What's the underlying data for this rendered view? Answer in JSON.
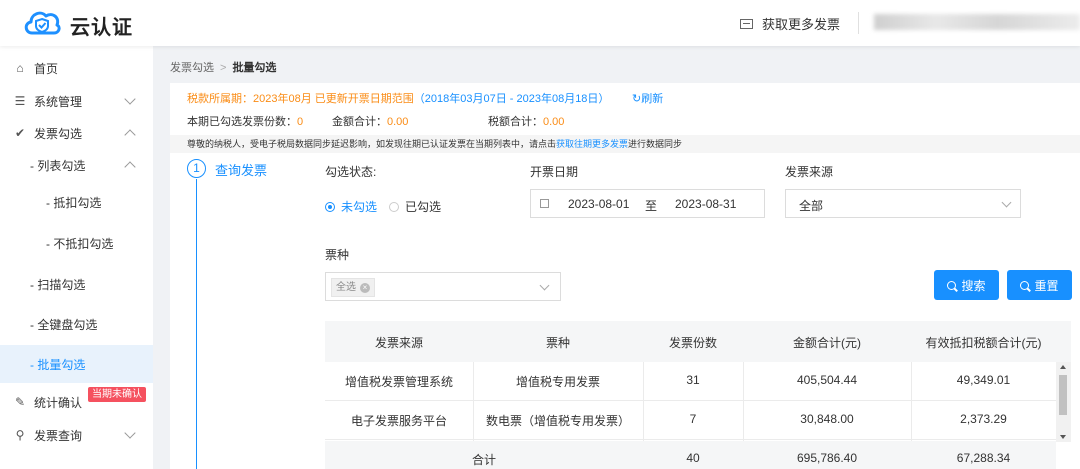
{
  "header": {
    "app_title": "云认证",
    "more_invoices": "获取更多发票"
  },
  "sidebar": {
    "items": [
      {
        "label": "首页",
        "icon": "home-icon"
      },
      {
        "label": "系统管理",
        "icon": "settings-sliders-icon"
      },
      {
        "label": "发票勾选",
        "icon": "check-circle-icon"
      },
      {
        "label": "- 列表勾选"
      },
      {
        "label": "- 抵扣勾选"
      },
      {
        "label": "- 不抵扣勾选"
      },
      {
        "label": "- 扫描勾选"
      },
      {
        "label": "- 全键盘勾选"
      },
      {
        "label": "- 批量勾选"
      },
      {
        "label": "统计确认",
        "icon": "edit-icon"
      },
      {
        "label": "发票查询",
        "icon": "search-icon"
      }
    ],
    "badge": "当期未确认"
  },
  "breadcrumb": {
    "parent": "发票勾选",
    "current": "批量勾选"
  },
  "period": {
    "prefix": "税款所属期：2023年08月 已更新开票日期范围",
    "range": "（2018年03月07日 - 2023年08月18日）",
    "refresh": "刷新"
  },
  "stats": {
    "count_label": "本期已勾选发票份数：",
    "count_value": "0",
    "amount_label": "金额合计：",
    "amount_value": "0.00",
    "tax_label": "税额合计：",
    "tax_value": "0.00"
  },
  "notice": {
    "text": "尊敬的纳税人，受电子税局数据同步延迟影响，如发现往期已认证发票在当期列表中，请点击",
    "link": "获取往期更多发票",
    "suffix": "进行数据同步"
  },
  "step": {
    "number": "1",
    "title": "查询发票"
  },
  "filters": {
    "status_label": "勾选状态:",
    "status_options": [
      "未勾选",
      "已勾选"
    ],
    "date_label": "开票日期",
    "date_from": "2023-08-01",
    "date_sep": "至",
    "date_to": "2023-08-31",
    "source_label": "发票来源",
    "source_value": "全部",
    "type_label": "票种",
    "type_tag": "全选",
    "search_button": "搜索",
    "reset_button": "重置"
  },
  "table": {
    "headers": [
      "发票来源",
      "票种",
      "发票份数",
      "金额合计(元)",
      "有效抵扣税额合计(元)"
    ],
    "rows": [
      [
        "增值税发票管理系统",
        "增值税专用发票",
        "31",
        "405,504.44",
        "49,349.01"
      ],
      [
        "电子发票服务平台",
        "数电票（增值税专用发票）",
        "7",
        "30,848.00",
        "2,373.29"
      ]
    ],
    "summary": [
      "合计",
      "40",
      "695,786.40",
      "67,288.34"
    ]
  },
  "colors": {
    "accent": "#1890ff",
    "warning": "#fa8c16",
    "badge": "#f5515f"
  }
}
